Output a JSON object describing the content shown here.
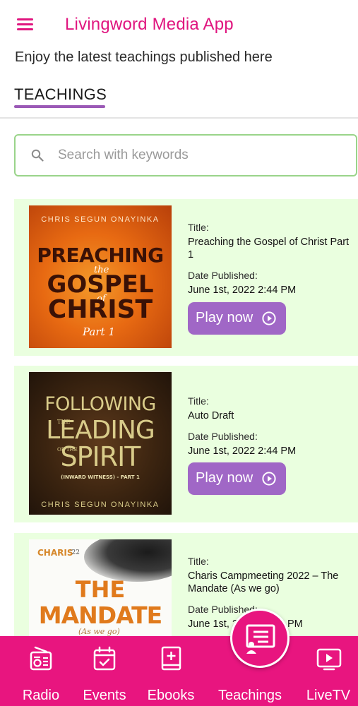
{
  "header": {
    "title": "Livingword Media App",
    "subtitle": "Enjoy the latest teachings published here"
  },
  "tab": {
    "label": "TEACHINGS"
  },
  "search": {
    "placeholder": "Search with keywords",
    "value": ""
  },
  "labels": {
    "title": "Title:",
    "date": "Date Published:",
    "play": "Play now"
  },
  "teachings": [
    {
      "title": "Preaching the Gospel of Christ Part 1",
      "date": "June 1st, 2022 2:44 PM",
      "cover": {
        "author": "CHRIS SEGUN ONAYINKA",
        "lines": [
          "PREACHING",
          "the",
          "GOSPEL",
          "of",
          "CHRIST",
          "Part 1"
        ]
      }
    },
    {
      "title": "Auto Draft",
      "date": "June 1st, 2022 2:44 PM",
      "cover": {
        "author": "CHRIS SEGUN ONAYINKA",
        "lines": [
          "FOLLOWING",
          "THE",
          "LEADING",
          "OF THE",
          "SPIRIT",
          "(INWARD WITNESS) - PART 1"
        ]
      }
    },
    {
      "title": "Charis Campmeeting 2022 – The Mandate (As we go)",
      "date": "June 1st, 20",
      "date_tail": "PM",
      "cover": {
        "brand": "CHARIS",
        "brand_year": "'22",
        "lines": [
          "THE",
          "MANDATE",
          "(As we go)"
        ]
      }
    }
  ],
  "bottom_nav": [
    {
      "label": "Radio",
      "icon": "radio-icon"
    },
    {
      "label": "Events",
      "icon": "calendar-icon"
    },
    {
      "label": "Ebooks",
      "icon": "book-icon"
    },
    {
      "label": "Teachings",
      "icon": "teaching-board-icon",
      "active": true
    },
    {
      "label": "LiveTV",
      "icon": "tv-play-icon"
    }
  ],
  "colors": {
    "brand": "#e8157f",
    "accent": "#a067c6",
    "card_bg": "#eaffdf",
    "search_border": "#9ad48a"
  }
}
